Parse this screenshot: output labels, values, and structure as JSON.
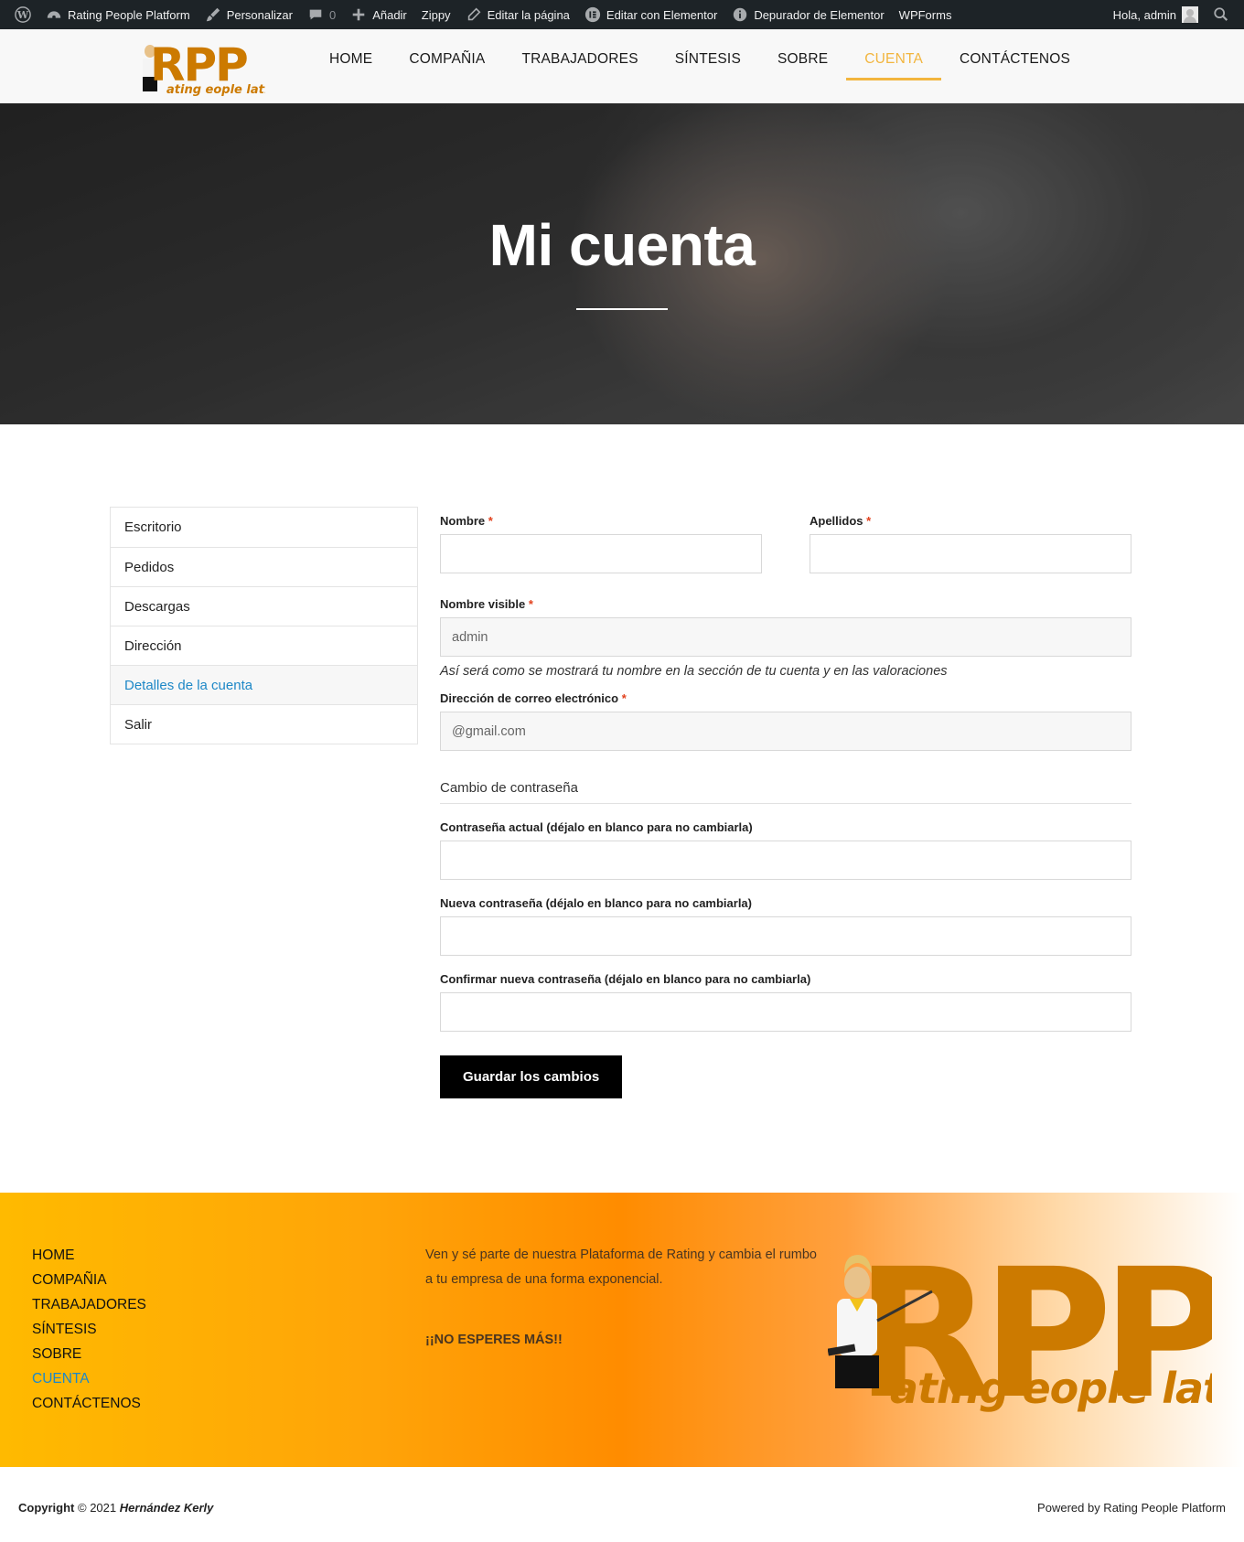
{
  "admin_bar": {
    "site_name": "Rating People Platform",
    "customize": "Personalizar",
    "comments_count": "0",
    "add_new": "Añadir",
    "zippy": "Zippy",
    "edit_page": "Editar la página",
    "edit_elementor": "Editar con Elementor",
    "elementor_debugger": "Depurador de Elementor",
    "wpforms": "WPForms",
    "greeting": "Hola, admin"
  },
  "header": {
    "logo_text": "RPP",
    "logo_sub": "ating eople latform",
    "nav": [
      {
        "label": "HOME"
      },
      {
        "label": "COMPAÑIA"
      },
      {
        "label": "TRABAJADORES"
      },
      {
        "label": "SÍNTESIS"
      },
      {
        "label": "SOBRE"
      },
      {
        "label": "CUENTA"
      },
      {
        "label": "CONTÁCTENOS"
      }
    ],
    "active_nav": "CUENTA",
    "accent_color": "#f2b53e"
  },
  "hero": {
    "title": "Mi cuenta"
  },
  "account_nav": {
    "items": [
      {
        "label": "Escritorio"
      },
      {
        "label": "Pedidos"
      },
      {
        "label": "Descargas"
      },
      {
        "label": "Dirección"
      },
      {
        "label": "Detalles de la cuenta"
      },
      {
        "label": "Salir"
      }
    ],
    "active": "Detalles de la cuenta"
  },
  "form": {
    "first_name_label": "Nombre",
    "last_name_label": "Apellidos",
    "display_name_label": "Nombre visible",
    "display_name_value": "admin",
    "display_name_hint": "Así será como se mostrará tu nombre en la sección de tu cuenta y en las valoraciones",
    "email_label": "Dirección de correo electrónico",
    "email_value": "@gmail.com",
    "required_mark": "*",
    "password_legend": "Cambio de contraseña",
    "current_password_label": "Contraseña actual (déjalo en blanco para no cambiarla)",
    "new_password_label": "Nueva contraseña (déjalo en blanco para no cambiarla)",
    "confirm_password_label": "Confirmar nueva contraseña (déjalo en blanco para no cambiarla)",
    "save_button": "Guardar los cambios"
  },
  "footer": {
    "nav": [
      {
        "label": "HOME"
      },
      {
        "label": "COMPAÑIA"
      },
      {
        "label": "TRABAJADORES"
      },
      {
        "label": "SÍNTESIS"
      },
      {
        "label": "SOBRE"
      },
      {
        "label": "CUENTA"
      },
      {
        "label": "CONTÁCTENOS"
      }
    ],
    "active_nav": "CUENTA",
    "text": "Ven y sé parte de nuestra Plataforma de Rating y cambia el rumbo a tu empresa de una forma exponencial.",
    "cta": "¡¡NO ESPERES MÁS!!",
    "logo_text": "RPP",
    "logo_sub": "ating eople latform"
  },
  "bottom": {
    "copyright_word": "Copyright",
    "copyright_rest": "© 2021",
    "author": "Hernández Kerly",
    "powered": "Powered by Rating People Platform"
  }
}
